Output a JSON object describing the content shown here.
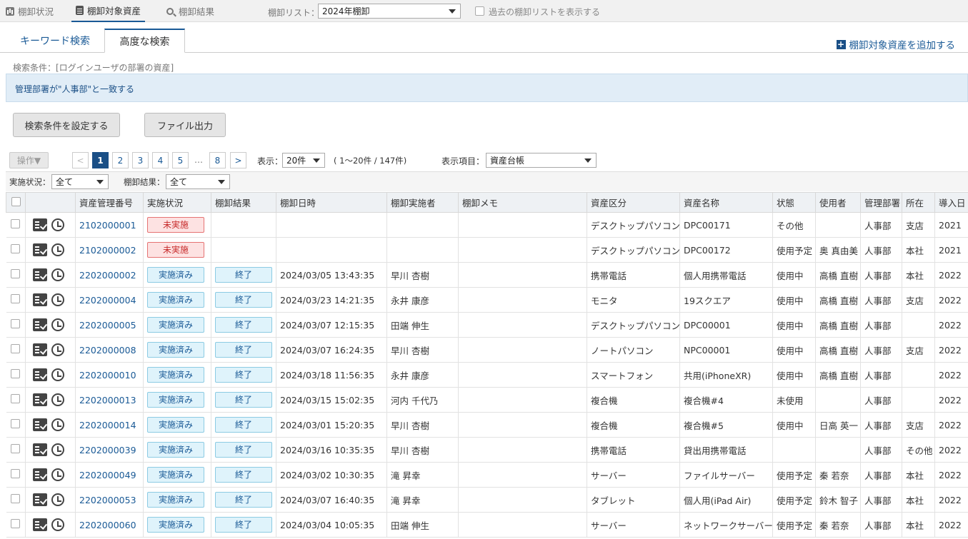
{
  "nav": {
    "items": [
      {
        "label": "棚卸状況",
        "icon": "bar-chart-icon"
      },
      {
        "label": "棚卸対象資産",
        "icon": "clipboard-icon"
      },
      {
        "label": "棚卸結果",
        "icon": "search-icon"
      }
    ],
    "list_label": "棚卸リスト：",
    "list_value": "2024年棚卸",
    "past_label": "過去の棚卸リストを表示する"
  },
  "tabs": {
    "keyword": "キーワード検索",
    "advanced": "高度な検索"
  },
  "add_asset_label": "棚卸対象資産を追加する",
  "search": {
    "condition_label": "検索条件：[ログインユーザの部署の資産]",
    "condition_text": "管理部署が\"人事部\"と一致する",
    "set_button": "検索条件を設定する",
    "export_button": "ファイル出力"
  },
  "toolbar": {
    "op_button": "操作▼",
    "pages": [
      "1",
      "2",
      "3",
      "4",
      "5",
      "…",
      "8"
    ],
    "prev": "<",
    "next": ">",
    "display_label": "表示：",
    "display_value": "20件",
    "range_text": "( 1～20件 / 147件)",
    "columns_label": "表示項目：",
    "columns_value": "資産台帳"
  },
  "filter": {
    "status_label": "実施状況：",
    "status_value": "全て",
    "result_label": "棚卸結果：",
    "result_value": "全て"
  },
  "table": {
    "headers": [
      "資産管理番号",
      "実施状況",
      "棚卸結果",
      "棚卸日時",
      "棚卸実施者",
      "棚卸メモ",
      "資産区分",
      "資産名称",
      "状態",
      "使用者",
      "管理部署",
      "所在",
      "導入日"
    ],
    "rows": [
      {
        "id": "2102000001",
        "status": "未実施",
        "result": "",
        "datetime": "",
        "person": "",
        "memo": "",
        "category": "デスクトップパソコン",
        "name": "DPC00171",
        "state": "その他",
        "user": "",
        "dept": "人事部",
        "location": "支店",
        "date": "2021"
      },
      {
        "id": "2102000002",
        "status": "未実施",
        "result": "",
        "datetime": "",
        "person": "",
        "memo": "",
        "category": "デスクトップパソコン",
        "name": "DPC00172",
        "state": "使用予定",
        "user": "奥 真由美",
        "dept": "人事部",
        "location": "本社",
        "date": "2021"
      },
      {
        "id": "2202000002",
        "status": "実施済み",
        "result": "終了",
        "datetime": "2024/03/05 13:43:35",
        "person": "早川 杏樹",
        "memo": "",
        "category": "携帯電話",
        "name": "個人用携帯電話",
        "state": "使用中",
        "user": "高橋 直樹",
        "dept": "人事部",
        "location": "本社",
        "date": "2022"
      },
      {
        "id": "2202000004",
        "status": "実施済み",
        "result": "終了",
        "datetime": "2024/03/23 14:21:35",
        "person": "永井 康彦",
        "memo": "",
        "category": "モニタ",
        "name": "19スクエア",
        "state": "使用中",
        "user": "高橋 直樹",
        "dept": "人事部",
        "location": "支店",
        "date": "2022"
      },
      {
        "id": "2202000005",
        "status": "実施済み",
        "result": "終了",
        "datetime": "2024/03/07 12:15:35",
        "person": "田端 伸生",
        "memo": "",
        "category": "デスクトップパソコン",
        "name": "DPC00001",
        "state": "使用中",
        "user": "高橋 直樹",
        "dept": "人事部",
        "location": "",
        "date": "2022"
      },
      {
        "id": "2202000008",
        "status": "実施済み",
        "result": "終了",
        "datetime": "2024/03/07 16:24:35",
        "person": "早川 杏樹",
        "memo": "",
        "category": "ノートパソコン",
        "name": "NPC00001",
        "state": "使用中",
        "user": "高橋 直樹",
        "dept": "人事部",
        "location": "支店",
        "date": "2022"
      },
      {
        "id": "2202000010",
        "status": "実施済み",
        "result": "終了",
        "datetime": "2024/03/18 11:56:35",
        "person": "永井 康彦",
        "memo": "",
        "category": "スマートフォン",
        "name": "共用(iPhoneXR)",
        "state": "使用中",
        "user": "高橋 直樹",
        "dept": "人事部",
        "location": "",
        "date": "2022"
      },
      {
        "id": "2202000013",
        "status": "実施済み",
        "result": "終了",
        "datetime": "2024/03/15 15:02:35",
        "person": "河内 千代乃",
        "memo": "",
        "category": "複合機",
        "name": "複合機#4",
        "state": "未使用",
        "user": "",
        "dept": "人事部",
        "location": "",
        "date": "2022"
      },
      {
        "id": "2202000014",
        "status": "実施済み",
        "result": "終了",
        "datetime": "2024/03/01 15:20:35",
        "person": "早川 杏樹",
        "memo": "",
        "category": "複合機",
        "name": "複合機#5",
        "state": "使用中",
        "user": "日高 英一",
        "dept": "人事部",
        "location": "支店",
        "date": "2022"
      },
      {
        "id": "2202000039",
        "status": "実施済み",
        "result": "終了",
        "datetime": "2024/03/16 10:35:35",
        "person": "早川 杏樹",
        "memo": "",
        "category": "携帯電話",
        "name": "貸出用携帯電話",
        "state": "",
        "user": "",
        "dept": "人事部",
        "location": "その他",
        "date": "2022"
      },
      {
        "id": "2202000049",
        "status": "実施済み",
        "result": "終了",
        "datetime": "2024/03/02 10:30:35",
        "person": "滝 昇幸",
        "memo": "",
        "category": "サーバー",
        "name": "ファイルサーバー",
        "state": "使用予定",
        "user": "秦 若奈",
        "dept": "人事部",
        "location": "本社",
        "date": "2022"
      },
      {
        "id": "2202000053",
        "status": "実施済み",
        "result": "終了",
        "datetime": "2024/03/07 16:40:35",
        "person": "滝 昇幸",
        "memo": "",
        "category": "タブレット",
        "name": "個人用(iPad Air)",
        "state": "使用予定",
        "user": "鈴木 智子",
        "dept": "人事部",
        "location": "本社",
        "date": "2022"
      },
      {
        "id": "2202000060",
        "status": "実施済み",
        "result": "終了",
        "datetime": "2024/03/04 10:05:35",
        "person": "田端 伸生",
        "memo": "",
        "category": "サーバー",
        "name": "ネットワークサーバー",
        "state": "使用予定",
        "user": "秦 若奈",
        "dept": "人事部",
        "location": "本社",
        "date": "2022"
      }
    ]
  }
}
